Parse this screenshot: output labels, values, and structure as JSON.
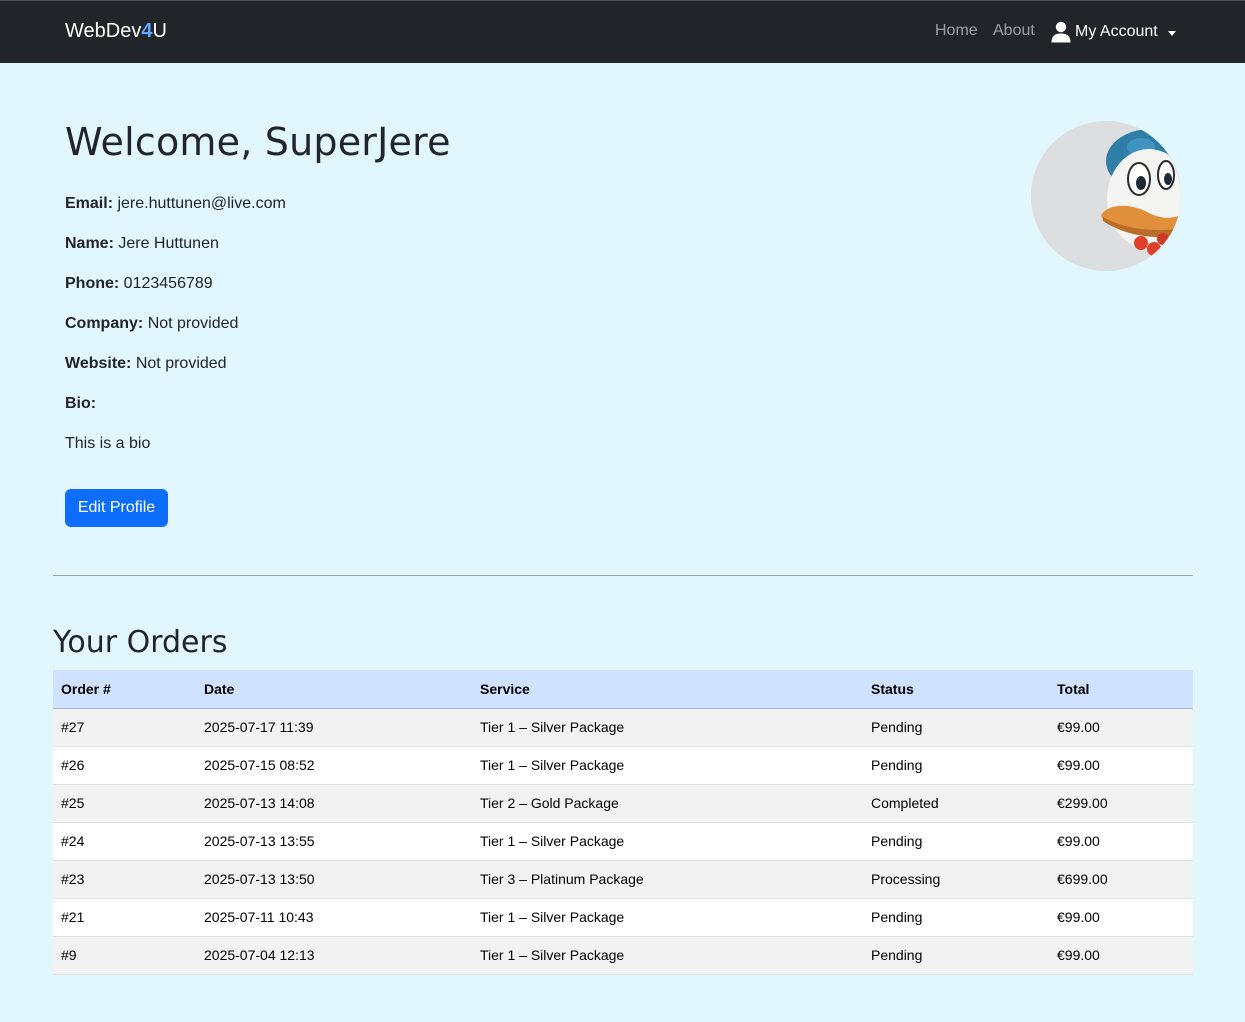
{
  "nav": {
    "brand_prefix": "WebDev",
    "brand_accent": "4",
    "brand_suffix": "U",
    "home": "Home",
    "about": "About",
    "account": "My Account"
  },
  "profile": {
    "welcome": "Welcome, SuperJere",
    "fields": [
      {
        "label": "Email:",
        "value": "jere.huttunen@live.com"
      },
      {
        "label": "Name:",
        "value": "Jere Huttunen"
      },
      {
        "label": "Phone:",
        "value": "0123456789"
      },
      {
        "label": "Company:",
        "value": "Not provided"
      },
      {
        "label": "Website:",
        "value": "Not provided"
      },
      {
        "label": "Bio:",
        "value": ""
      }
    ],
    "bio_text": "This is a bio",
    "edit_button": "Edit Profile"
  },
  "orders": {
    "title": "Your Orders",
    "columns": [
      "Order #",
      "Date",
      "Service",
      "Status",
      "Total"
    ],
    "rows": [
      [
        "#27",
        "2025-07-17 11:39",
        "Tier 1 – Silver Package",
        "Pending",
        "€99.00"
      ],
      [
        "#26",
        "2025-07-15 08:52",
        "Tier 1 – Silver Package",
        "Pending",
        "€99.00"
      ],
      [
        "#25",
        "2025-07-13 14:08",
        "Tier 2 – Gold Package",
        "Completed",
        "€299.00"
      ],
      [
        "#24",
        "2025-07-13 13:55",
        "Tier 1 – Silver Package",
        "Pending",
        "€99.00"
      ],
      [
        "#23",
        "2025-07-13 13:50",
        "Tier 3 – Platinum Package",
        "Processing",
        "€699.00"
      ],
      [
        "#21",
        "2025-07-11 10:43",
        "Tier 1 – Silver Package",
        "Pending",
        "€99.00"
      ],
      [
        "#9",
        "2025-07-04 12:13",
        "Tier 1 – Silver Package",
        "Pending",
        "€99.00"
      ]
    ]
  },
  "colors": {
    "navbar": "#212529",
    "page_background": "#e1f6fd",
    "primary": "#0d6efd",
    "table_header": "#cfe2ff"
  }
}
